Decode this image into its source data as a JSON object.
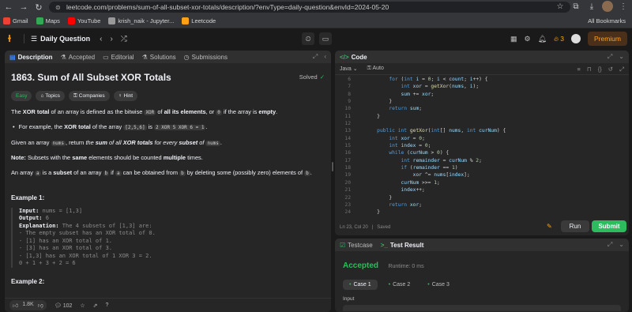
{
  "browser": {
    "url": "leetcode.com/problems/sum-of-all-subset-xor-totals/description/?envType=daily-question&envId=2024-05-20",
    "bookmarks": [
      "Gmail",
      "Maps",
      "YouTube",
      "krish_naik - Jupyter...",
      "Leetcode"
    ],
    "all_bookmarks": "All Bookmarks"
  },
  "topbar": {
    "daily_label": "Daily Question",
    "streak": "3",
    "premium": "Premium"
  },
  "desc_tabs": [
    "Description",
    "Accepted",
    "Editorial",
    "Solutions",
    "Submissions"
  ],
  "problem": {
    "title": "1863. Sum of All Subset XOR Totals",
    "solved": "Solved",
    "tags": [
      "Easy",
      "Topics",
      "Companies",
      "Hint"
    ],
    "p1_a": "The ",
    "p1_b": "XOR total",
    "p1_c": " of an array is defined as the bitwise ",
    "p1_code1": "XOR",
    "p1_d": " of ",
    "p1_e": "all its elements",
    "p1_f": ", or ",
    "p1_code2": "0",
    "p1_g": " if the array is ",
    "p1_h": "empty",
    "p1_i": ".",
    "bullet_a": "For example, the ",
    "bullet_b": "XOR total",
    "bullet_c": " of the array ",
    "bullet_code1": "[2,5,6]",
    "bullet_d": " is ",
    "bullet_code2": "2 XOR 5 XOR 6 = 1",
    "bullet_e": ".",
    "p2_a": "Given an array ",
    "p2_code1": "nums",
    "p2_b": ", return ",
    "p2_c": "the ",
    "p2_d": "sum",
    "p2_e": " of all ",
    "p2_f": "XOR totals",
    "p2_g": " for every ",
    "p2_h": "subset",
    "p2_i": " of ",
    "p2_code2": "nums",
    "p2_j": ".",
    "note_a": "Note:",
    "note_b": " Subsets with the ",
    "note_c": "same",
    "note_d": " elements should be counted ",
    "note_e": "multiple",
    "note_f": " times.",
    "p3_a": "An array ",
    "p3_code1": "a",
    "p3_b": " is a ",
    "p3_c": "subset",
    "p3_d": " of an array ",
    "p3_code2": "b",
    "p3_e": " if ",
    "p3_code3": "a",
    "p3_f": " can be obtained from ",
    "p3_code4": "b",
    "p3_g": " by deleting some (possibly zero) elements of ",
    "p3_code5": "b",
    "p3_h": ".",
    "example1_title": "Example 1:",
    "ex1_input_label": "Input:",
    "ex1_input": " nums = [1,3]",
    "ex1_output_label": "Output:",
    "ex1_output": " 6",
    "ex1_expl_label": "Explanation:",
    "ex1_expl": " The 4 subsets of [1,3] are:",
    "ex1_lines": [
      "- The empty subset has an XOR total of 0.",
      "- [1] has an XOR total of 1.",
      "- [3] has an XOR total of 3.",
      "- [1,3] has an XOR total of 1 XOR 3 = 2.",
      "0 + 1 + 3 + 2 = 6"
    ],
    "example2_title": "Example 2:"
  },
  "desc_footer": {
    "likes": "1.8K",
    "comments": "102"
  },
  "code_panel": {
    "title": "Code",
    "language": "Java",
    "autocomplete": "Auto",
    "status_pos": "Ln 23, Col 20",
    "status_saved": "Saved",
    "run": "Run",
    "submit": "Submit"
  },
  "code_lines": [
    {
      "n": "6",
      "t": "        for (int i = 0; i < count; i++) {"
    },
    {
      "n": "7",
      "t": "            int xor = getXor(nums, i);"
    },
    {
      "n": "8",
      "t": "            sum += xor;"
    },
    {
      "n": "9",
      "t": "        }"
    },
    {
      "n": "10",
      "t": "        return sum;"
    },
    {
      "n": "11",
      "t": "    }"
    },
    {
      "n": "12",
      "t": ""
    },
    {
      "n": "13",
      "t": "    public int getXor(int[] nums, int curNum) {"
    },
    {
      "n": "14",
      "t": "        int xor = 0;"
    },
    {
      "n": "15",
      "t": "        int index = 0;"
    },
    {
      "n": "16",
      "t": "        while (curNum > 0) {"
    },
    {
      "n": "17",
      "t": "            int remainder = curNum % 2;"
    },
    {
      "n": "18",
      "t": "            if (remainder == 1)"
    },
    {
      "n": "19",
      "t": "                xor ^= nums[index];"
    },
    {
      "n": "20",
      "t": "            curNum >>= 1;"
    },
    {
      "n": "21",
      "t": "            index++;"
    },
    {
      "n": "22",
      "t": "        }"
    },
    {
      "n": "23",
      "t": "        return xor;"
    },
    {
      "n": "24",
      "t": "    }"
    }
  ],
  "result_panel": {
    "tab_testcase": "Testcase",
    "tab_result": "Test Result",
    "status": "Accepted",
    "runtime": "Runtime: 0 ms",
    "cases": [
      "Case 1",
      "Case 2",
      "Case 3"
    ],
    "input_label": "Input"
  }
}
